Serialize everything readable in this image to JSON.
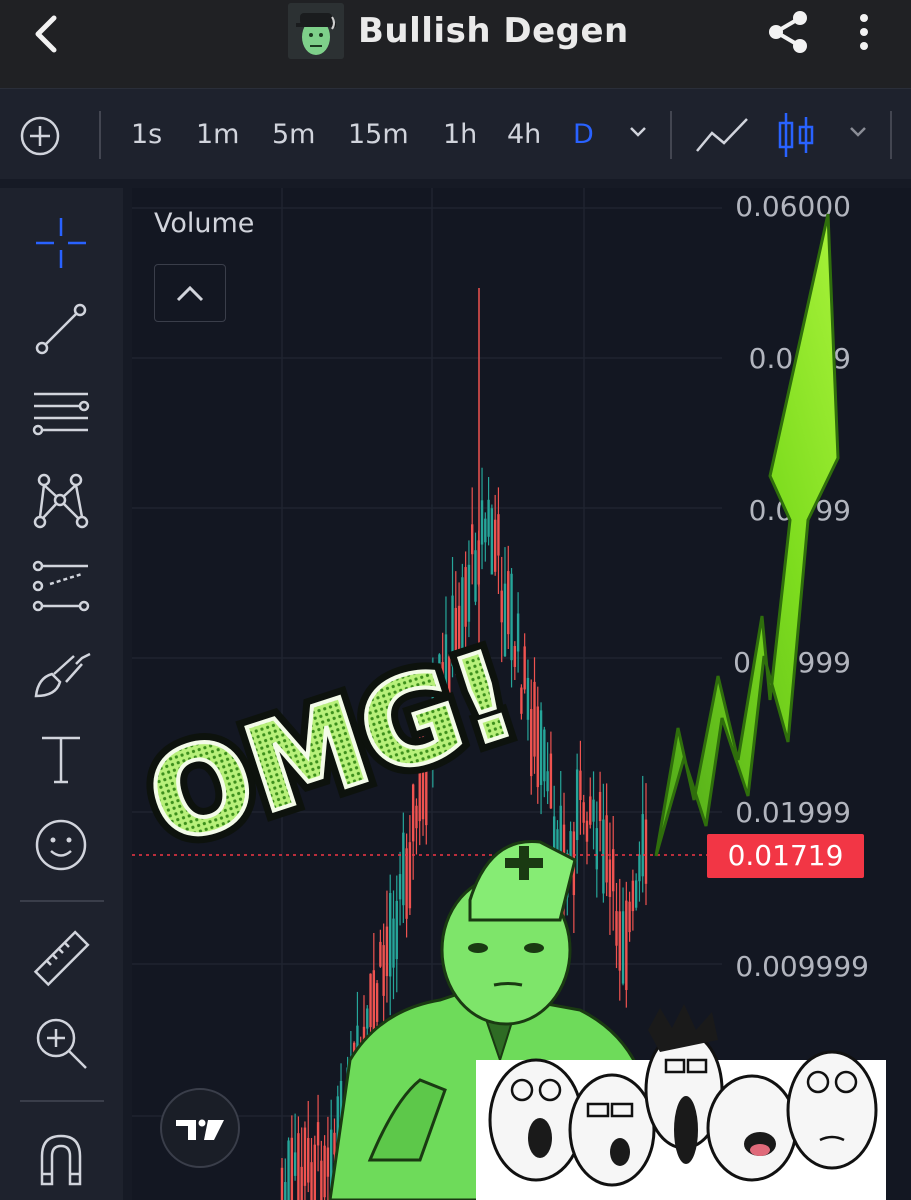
{
  "header": {
    "title": "Bullish Degen"
  },
  "toolbar": {
    "intervals": [
      "1s",
      "1m",
      "5m",
      "15m",
      "1h",
      "4h",
      "D"
    ],
    "active_interval": "D"
  },
  "chart": {
    "pane_label": "Volume",
    "price_labels": [
      "0.06000",
      "0.04",
      "9",
      "0.03",
      "99",
      "0",
      "999",
      "0.01999",
      "0.009999"
    ],
    "current_price": "0.01719",
    "accent_color": "#2962ff",
    "up_color": "#26a69a",
    "down_color": "#ef5350"
  },
  "overlay": {
    "meme_text": "OMG!"
  },
  "icons": {
    "header": [
      "back-arrow-icon",
      "avatar",
      "share-icon",
      "more-vertical-icon"
    ],
    "toolbar": [
      "add-circle-icon",
      "chevron-down-icon",
      "line-chart-icon",
      "candlestick-icon",
      "chevron-down-icon"
    ],
    "leftbar": [
      "crosshair-icon",
      "trend-line-icon",
      "horizontal-lines-icon",
      "pattern-icon",
      "fib-icon",
      "brush-icon",
      "text-icon",
      "emoji-icon",
      "ruler-icon",
      "zoom-in-icon",
      "magnet-icon"
    ]
  }
}
